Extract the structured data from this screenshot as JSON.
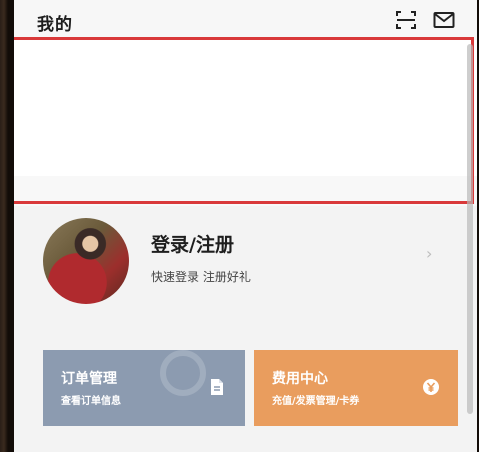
{
  "header": {
    "title": "我的"
  },
  "profile": {
    "login_title": "登录/注册",
    "login_subtitle": "快速登录  注册好礼",
    "chevron": "›"
  },
  "cards": {
    "orders": {
      "title": "订单管理",
      "subtitle": "查看订单信息",
      "icon": "document-icon"
    },
    "fees": {
      "title": "费用中心",
      "subtitle": "充值/发票管理/卡券",
      "icon": "yen-coin-icon"
    }
  },
  "colors": {
    "highlight": "#d9393a",
    "orders_card": "#8c9bb0",
    "fees_card": "#e99d5e"
  }
}
